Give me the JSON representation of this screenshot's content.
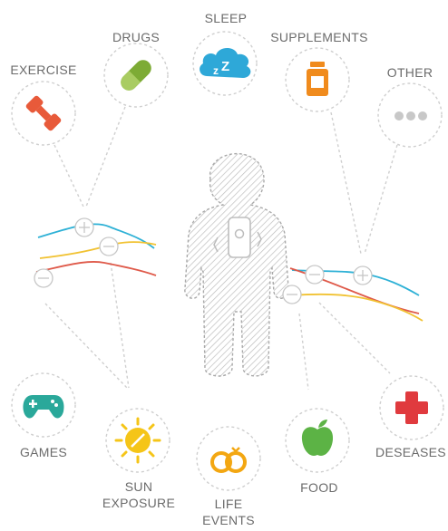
{
  "labels": {
    "sleep": "SLEEP",
    "drugs": "DRUGS",
    "supplements": "SUPPLEMENTS",
    "exercise": "EXERCISE",
    "other": "OTHER",
    "games": "GAMES",
    "sun_exposure_line1": "SUN",
    "sun_exposure_line2": "EXPOSURE",
    "life_events_line1": "LIFE",
    "life_events_line2": "EVENTS",
    "food": "FOOD",
    "deseases": "DESEASES"
  },
  "colors": {
    "line": "#cfcfcf",
    "label": "#6b6b6b",
    "sleep": "#2ea8d8",
    "drugs": "#7dab35",
    "supplements": "#f08b1d",
    "exercise": "#e85a3a",
    "other": "#c8c8c8",
    "games": "#2aa89a",
    "sun": "#f5c518",
    "life_events": "#f3a712",
    "food": "#5cb345",
    "deseases": "#e03a3e",
    "series_blue": "#2eb1d6",
    "series_yellow": "#f1c232",
    "series_red": "#df5a4a"
  },
  "icons": {
    "sleep": "cloud-zzz-icon",
    "drugs": "pill-capsule-icon",
    "supplements": "supplement-bottle-icon",
    "exercise": "dumbbell-icon",
    "other": "ellipsis-icon",
    "games": "gamepad-icon",
    "sun_exposure": "sun-icon",
    "life_events": "wedding-rings-icon",
    "food": "apple-icon",
    "deseases": "red-cross-icon"
  }
}
